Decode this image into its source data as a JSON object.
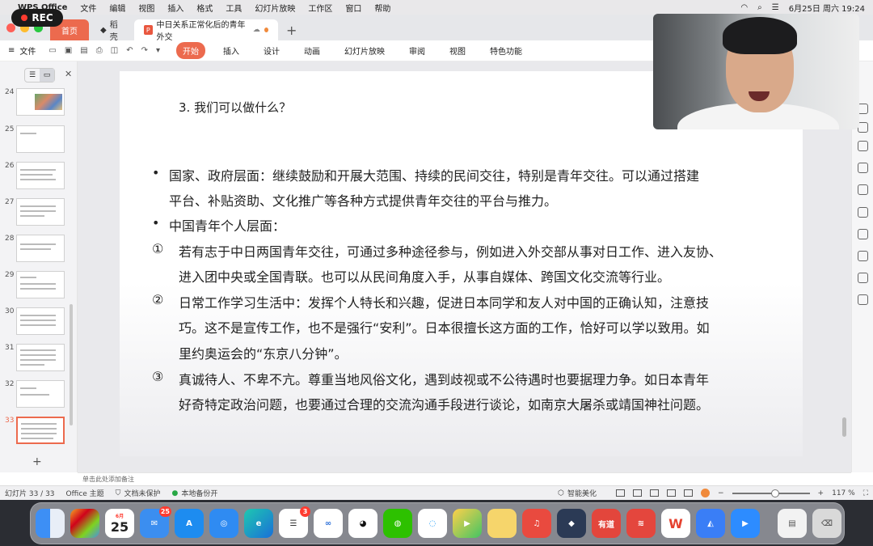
{
  "rec": {
    "label": "REC"
  },
  "menubar": {
    "app_name": "WPS Office",
    "items": [
      "文件",
      "编辑",
      "视图",
      "插入",
      "格式",
      "工具",
      "幻灯片放映",
      "工作区",
      "窗口",
      "帮助"
    ],
    "datetime": "6月25日 周六 19:24"
  },
  "tabs": {
    "home": "首页",
    "docer": "稻壳",
    "doc": "中日关系正常化后的青年外交"
  },
  "toolbar": {
    "file": "文件",
    "ribbon": [
      "开始",
      "插入",
      "设计",
      "动画",
      "幻灯片放映",
      "审阅",
      "视图",
      "特色功能"
    ],
    "active_ribbon": "开始"
  },
  "thumbnails": [
    "24",
    "25",
    "26",
    "27",
    "28",
    "29",
    "30",
    "31",
    "32",
    "33"
  ],
  "slide": {
    "heading": "3. 我们可以做什么？",
    "bullet1_line1": "国家、政府层面：继续鼓励和开展大范围、持续的民间交往，特别是青年交往。可以通过搭建",
    "bullet1_line2": "平台、补贴资助、文化推广等各种方式提供青年交往的平台与推力。",
    "bullet2": "中国青年个人层面：",
    "item1_num": "①",
    "item1_line1": "若有志于中日两国青年交往，可通过多种途径参与，例如进入外交部从事对日工作、进入友协、",
    "item1_line2": "进入团中央或全国青联。也可以从民间角度入手，从事自媒体、跨国文化交流等行业。",
    "item2_num": "②",
    "item2_line1": "日常工作学习生活中：发挥个人特长和兴趣，促进日本同学和友人对中国的正确认知，注意技",
    "item2_line2": "巧。这不是宣传工作，也不是强行“安利”。日本很擅长这方面的工作，恰好可以学以致用。如",
    "item2_line3": "里约奥运会的“东京八分钟”。",
    "item3_num": "③",
    "item3_line1": "真诚待人、不卑不亢。尊重当地风俗文化，遇到歧视或不公待遇时也要据理力争。如日本青年",
    "item3_line2": "好奇特定政治问题，也要通过合理的交流沟通手段进行谈论，如南京大屠杀或靖国神社问题。"
  },
  "notes": {
    "placeholder": "单击此处添加备注"
  },
  "status": {
    "slide_count": "幻灯片 33 / 33",
    "theme": "Office 主题",
    "protect": "文档未保护",
    "backup": "本地备份开",
    "beautify": "智能美化",
    "zoom": "117 %"
  },
  "dock": {
    "calendar_month": "6月",
    "calendar_day": "25",
    "mail_badge": "25",
    "reminders_badge": "3",
    "youdao": "有道",
    "wps": "W"
  },
  "colors": {
    "accent": "#ec6a4e",
    "rec_dot": "#ff3b30"
  }
}
